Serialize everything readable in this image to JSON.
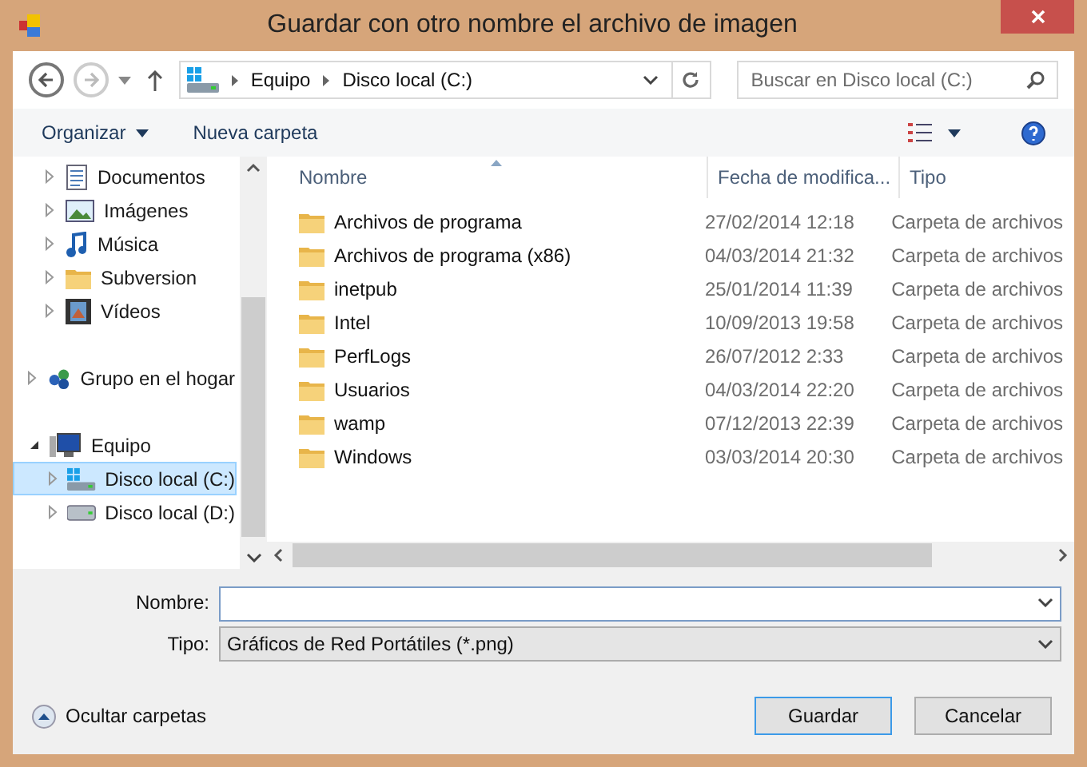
{
  "window": {
    "title": "Guardar con otro nombre el archivo de imagen"
  },
  "address": {
    "crumbs": [
      "Equipo",
      "Disco local (C:)"
    ]
  },
  "search": {
    "placeholder": "Buscar en Disco local (C:)"
  },
  "toolbar": {
    "organize": "Organizar",
    "new_folder": "Nueva carpeta"
  },
  "libraries": [
    {
      "label": "Documentos",
      "kind": "document",
      "selected": false
    },
    {
      "label": "Imágenes",
      "kind": "picture",
      "selected": false
    },
    {
      "label": "Música",
      "kind": "music",
      "selected": false
    },
    {
      "label": "Subversion",
      "kind": "folder",
      "selected": false
    },
    {
      "label": "Vídeos",
      "kind": "video",
      "selected": false
    }
  ],
  "tree": [
    {
      "label": "Grupo en el hogar",
      "kind": "homegroup",
      "selected": false,
      "expanded": false
    },
    {
      "label": "Equipo",
      "kind": "computer",
      "selected": false,
      "expanded": true,
      "children": [
        {
          "label": "Disco local (C:)",
          "kind": "system-drive",
          "selected": true,
          "expanded": false
        },
        {
          "label": "Disco local (D:)",
          "kind": "drive",
          "selected": false,
          "expanded": false
        }
      ]
    }
  ],
  "table": {
    "columns": [
      "Nombre",
      "Fecha de modifica...",
      "Tipo"
    ],
    "rows": [
      {
        "name": "Archivos de programa",
        "date": "27/02/2014 12:18",
        "type": "Carpeta de archivos"
      },
      {
        "name": "Archivos de programa (x86)",
        "date": "04/03/2014 21:32",
        "type": "Carpeta de archivos"
      },
      {
        "name": "inetpub",
        "date": "25/01/2014 11:39",
        "type": "Carpeta de archivos"
      },
      {
        "name": "Intel",
        "date": "10/09/2013 19:58",
        "type": "Carpeta de archivos"
      },
      {
        "name": "PerfLogs",
        "date": "26/07/2012 2:33",
        "type": "Carpeta de archivos"
      },
      {
        "name": "Usuarios",
        "date": "04/03/2014 22:20",
        "type": "Carpeta de archivos"
      },
      {
        "name": "wamp",
        "date": "07/12/2013 22:39",
        "type": "Carpeta de archivos"
      },
      {
        "name": "Windows",
        "date": "03/03/2014 20:30",
        "type": "Carpeta de archivos"
      }
    ]
  },
  "form": {
    "name_label": "Nombre:",
    "type_label": "Tipo:",
    "type_value": "Gráficos de Red Portátiles (*.png)"
  },
  "hide_folders": "Ocultar carpetas",
  "buttons": [
    {
      "label": "Guardar",
      "kind": "default"
    },
    {
      "label": "Cancelar",
      "kind": "normal"
    }
  ]
}
